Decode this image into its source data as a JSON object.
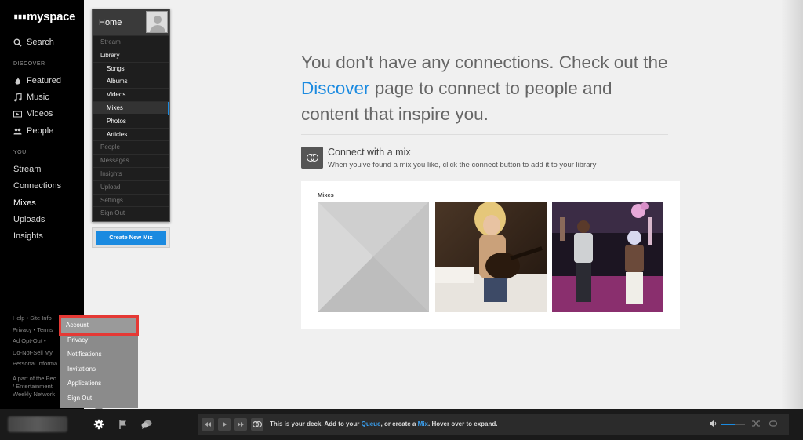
{
  "brand": {
    "dots": "∎∎∎",
    "name": "myspace"
  },
  "sidebar": {
    "search_label": "Search",
    "discover_label": "DISCOVER",
    "discover_items": [
      {
        "label": "Featured",
        "icon": "flame-icon"
      },
      {
        "label": "Music",
        "icon": "music-note-icon"
      },
      {
        "label": "Videos",
        "icon": "video-icon"
      },
      {
        "label": "People",
        "icon": "people-icon"
      }
    ],
    "you_label": "YOU",
    "you_items": [
      "Stream",
      "Connections",
      "Mixes",
      "Uploads",
      "Insights"
    ],
    "active_item": "Mixes",
    "footer": {
      "line1": "Help  •  Site Info",
      "line2": "Privacy  •  Terms",
      "line3": "Ad Opt-Out  •",
      "line4": "Do-Not-Sell My",
      "line5": "Personal Informa",
      "small1": "A part of the Peo",
      "small2": "/ Entertainment",
      "small3": "Weekly Network"
    }
  },
  "home_panel": {
    "title": "Home",
    "items": [
      {
        "label": "Stream",
        "style": "dim"
      },
      {
        "label": "Library",
        "style": "lib"
      },
      {
        "label": "Songs",
        "style": "sub"
      },
      {
        "label": "Albums",
        "style": "sub"
      },
      {
        "label": "Videos",
        "style": "sub"
      },
      {
        "label": "Mixes",
        "style": "sub sel"
      },
      {
        "label": "Photos",
        "style": "sub"
      },
      {
        "label": "Articles",
        "style": "sub"
      },
      {
        "label": "People",
        "style": "dim"
      },
      {
        "label": "Messages",
        "style": "dim"
      },
      {
        "label": "Insights",
        "style": "dim"
      },
      {
        "label": "Upload",
        "style": "dim"
      },
      {
        "label": "Settings",
        "style": "dim"
      },
      {
        "label": "Sign Out",
        "style": "dim"
      }
    ],
    "create_button": "Create New Mix"
  },
  "main": {
    "message_part1": "You don't have any connections. Check out the ",
    "message_link": "Discover",
    "message_part2": " page to connect to people and content that inspire you.",
    "connect_title": "Connect with a mix",
    "connect_subtitle": "When you've found a mix you like, click the connect button to add it to your library",
    "mixes_label": "Mixes"
  },
  "account_menu": {
    "items": [
      "Account",
      "Privacy",
      "Notifications",
      "Invitations",
      "Applications",
      "Sign Out"
    ],
    "highlighted": "Account"
  },
  "player": {
    "deck_text_1": "This is your deck. Add to your ",
    "queue_link": "Queue",
    "deck_text_2": ", or create a ",
    "mix_link": "Mix",
    "deck_text_3": ". Hover over to expand.",
    "volume_level": 0.55
  },
  "colors": {
    "accent": "#1a8ae0",
    "highlight_border": "#e53935",
    "sidebar_bg": "#000000"
  }
}
